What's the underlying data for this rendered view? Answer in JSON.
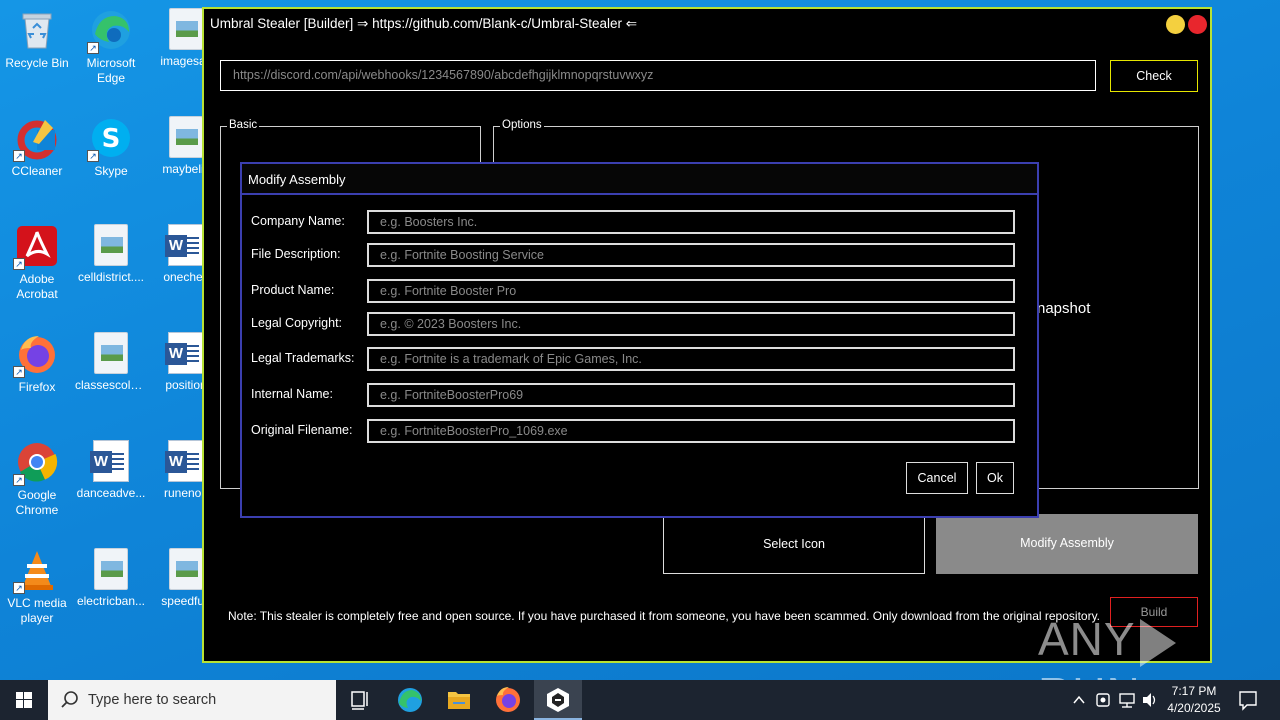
{
  "desktop": {
    "icons": [
      {
        "label": "Recycle Bin",
        "icon": "recycle-bin-icon"
      },
      {
        "label": "Microsoft Edge",
        "icon": "edge-icon"
      },
      {
        "label": "imagesac",
        "icon": "image-file-icon"
      },
      {
        "label": "CCleaner",
        "icon": "ccleaner-icon"
      },
      {
        "label": "Skype",
        "icon": "skype-icon"
      },
      {
        "label": "maybelis",
        "icon": "image-file-icon"
      },
      {
        "label": "Adobe Acrobat",
        "icon": "acrobat-icon"
      },
      {
        "label": "celldistrict....",
        "icon": "image-file-icon"
      },
      {
        "label": "onechec",
        "icon": "word-doc-icon"
      },
      {
        "label": "Firefox",
        "icon": "firefox-icon"
      },
      {
        "label": "classescold...",
        "icon": "image-file-icon"
      },
      {
        "label": "position",
        "icon": "word-doc-icon"
      },
      {
        "label": "Google Chrome",
        "icon": "chrome-icon"
      },
      {
        "label": "danceadve...",
        "icon": "word-doc-icon"
      },
      {
        "label": "runenou",
        "icon": "word-doc-icon"
      },
      {
        "label": "VLC media player",
        "icon": "vlc-icon"
      },
      {
        "label": "electricban...",
        "icon": "image-file-icon"
      },
      {
        "label": "speedfun",
        "icon": "image-file-icon"
      }
    ]
  },
  "builder": {
    "title": "Umbral Stealer [Builder] ⇒ https://github.com/Blank-c/Umbral-Stealer ⇐",
    "webhook_value": "https://discord.com/api/webhooks/1234567890/abcdefhgijklmnopqrstuvwxyz",
    "check_label": "Check",
    "basic_label": "Basic",
    "options_label": "Options",
    "partial_option_text": "napshot",
    "select_icon_label": "Select Icon",
    "modify_assembly_label": "Modify Assembly",
    "note": "Note: This stealer is completely free and open source. If you have purchased it from someone, you have been scammed. Only download from the original repository.",
    "build_label": "Build",
    "colors": {
      "border": "#b8e234",
      "minimize": "#f4d03f",
      "close": "#e8262d",
      "check_border": "#e6e600",
      "build_border": "#e02020"
    }
  },
  "modal": {
    "title": "Modify Assembly",
    "fields": [
      {
        "label": "Company Name:",
        "placeholder": "e.g. Boosters Inc."
      },
      {
        "label": "File Description:",
        "placeholder": "e.g. Fortnite Boosting Service"
      },
      {
        "label": "Product Name:",
        "placeholder": "e.g. Fortnite Booster Pro"
      },
      {
        "label": "Legal Copyright:",
        "placeholder": "e.g. © 2023 Boosters Inc."
      },
      {
        "label": "Legal Trademarks:",
        "placeholder": "e.g. Fortnite is a trademark of Epic Games, Inc."
      },
      {
        "label": "Internal Name:",
        "placeholder": "e.g. FortniteBoosterPro69"
      },
      {
        "label": "Original Filename:",
        "placeholder": "e.g. FortniteBoosterPro_1069.exe"
      }
    ],
    "cancel_label": "Cancel",
    "ok_label": "Ok"
  },
  "taskbar": {
    "search_placeholder": "Type here to search",
    "pinned": [
      "task-view-icon",
      "edge-icon",
      "file-explorer-icon",
      "firefox-icon",
      "umbral-app-icon"
    ],
    "clock_time": "7:17 PM",
    "clock_date": "4/20/2025"
  },
  "watermark": {
    "text_left": "ANY",
    "text_right": "RUN"
  }
}
